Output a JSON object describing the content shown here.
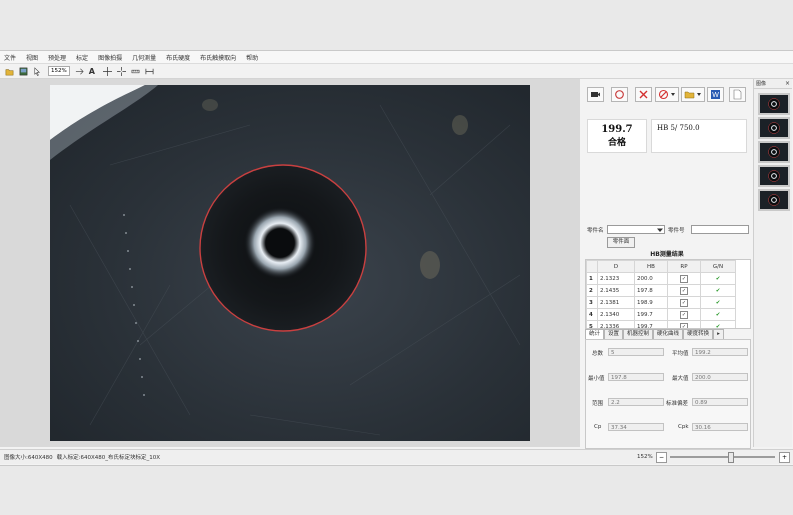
{
  "menu": [
    "文件",
    "视图",
    "预处理",
    "标定",
    "图像拍摄",
    "几何测量",
    "布氏硬度",
    "布氏触摸取向",
    "帮助"
  ],
  "toolbar": {
    "zoom": "152%"
  },
  "readout": {
    "value": "199.7",
    "status": "合格",
    "spec": "HB 5/ 750.0"
  },
  "part": {
    "name_label": "零件名",
    "number_label": "零件号",
    "name_value": "",
    "number_value": "",
    "button": "零件面"
  },
  "results": {
    "title": "HB测量结果",
    "columns": [
      "",
      "D",
      "HB",
      "RP",
      "G/N"
    ],
    "rows": [
      {
        "n": "1",
        "d": "2.1323",
        "hb": "200.0"
      },
      {
        "n": "2",
        "d": "2.1435",
        "hb": "197.8"
      },
      {
        "n": "3",
        "d": "2.1381",
        "hb": "198.9"
      },
      {
        "n": "4",
        "d": "2.1340",
        "hb": "199.7"
      },
      {
        "n": "5",
        "d": "2.1336",
        "hb": "199.7"
      }
    ]
  },
  "tabs": [
    "统计",
    "设置",
    "机器控制",
    "硬化曲线",
    "硬度转换"
  ],
  "stats": {
    "total_label": "总数",
    "total": "5",
    "avg_label": "平均值",
    "avg": "199.2",
    "min_label": "最小值",
    "min": "197.8",
    "max_label": "最大值",
    "max": "200.0",
    "range_label": "范围",
    "range": "2.2",
    "std_label": "标准偏差",
    "std": "0.89",
    "cp_label": "Cp",
    "cp": "37.34",
    "cpk_label": "Cpk",
    "cpk": "30.16"
  },
  "thumbs": {
    "title": "图像"
  },
  "status": {
    "size": "图像大小:640X480",
    "calibration": "载入标定:640X480_布氏标定块标定_10X",
    "zoom": "152%"
  },
  "colors": {
    "accent": "#c94040",
    "ok": "#2c9a2c",
    "reject": "#d43030",
    "save": "#2a5bb3",
    "folder": "#e2b43a"
  }
}
